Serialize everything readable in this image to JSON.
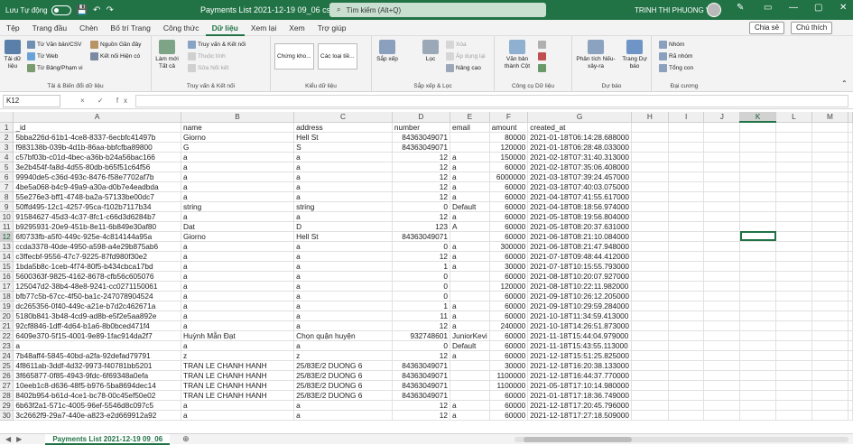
{
  "title_bar": {
    "autosave_label": "Lưu Tự động",
    "autosave_state": "off",
    "doc_title": "Payments List 2021-12-19 09_06 csv.csv",
    "search_placeholder": "Tìm kiếm (Alt+Q)",
    "user_name": "TRINH THI PHUONG VI"
  },
  "tabs": [
    "Tệp",
    "Trang đầu",
    "Chèn",
    "Bố trí Trang",
    "Công thức",
    "Dữ liệu",
    "Xem lại",
    "Xem",
    "Trợ giúp"
  ],
  "active_tab": "Dữ liệu",
  "share_label": "Chia sẻ",
  "comment_label": "Chú thích",
  "ribbon": {
    "g1": {
      "big": "Tải dữ liệu",
      "items": [
        "Từ Văn bản/CSV",
        "Từ Web",
        "Từ Bảng/Phạm vi",
        "Nguồn Gần đây",
        "Kết nối Hiện có"
      ],
      "label": "Tải & Biến đổi dữ liệu"
    },
    "g2": {
      "big": "Làm mới Tất cả",
      "items": [
        "Truy vấn & Kết nối",
        "Thuộc tính",
        "Sửa Nối kết"
      ],
      "label": "Truy vấn & Kết nối"
    },
    "g3": {
      "items": [
        "Chứng kho...",
        "Các loại tiề..."
      ],
      "label": "Kiểu dữ liệu"
    },
    "g4": {
      "items": [
        "Sắp xếp",
        "Lọc",
        "Xóa",
        "Áp dụng lại",
        "Nâng cao"
      ],
      "label": "Sắp xếp & Lọc"
    },
    "g5": {
      "items": [
        "Văn bản thành Cột"
      ],
      "label": "Công cụ Dữ liệu"
    },
    "g6": {
      "items": [
        "Phân tích Nếu-xảy-ra",
        "Trang Dự báo"
      ],
      "label": "Dự báo"
    },
    "g7": {
      "items": [
        "Nhóm",
        "Rã nhóm",
        "Tổng con"
      ],
      "label": "Đại cương"
    }
  },
  "formula_bar": {
    "name_box": "K12",
    "fx": "× ✓ fx",
    "value": ""
  },
  "columns": [
    "A",
    "B",
    "C",
    "D",
    "E",
    "F",
    "G",
    "H",
    "I",
    "J",
    "K",
    "L",
    "M"
  ],
  "selected_cell": {
    "row": 12,
    "col": "K"
  },
  "rows": [
    [
      "_id",
      "name",
      "address",
      "number",
      "email",
      "amount",
      "created_at"
    ],
    [
      "5bba226d-61b1-4ce8-8337-6ecbfc41497b",
      "Giorno",
      "Hell St",
      "84363049071",
      "",
      "80000",
      "2021-01-18T06:14:28.688000"
    ],
    [
      "f983138b-039b-4d1b-86aa-bbfcfba89800",
      "G",
      "S",
      "84363049071",
      "",
      "120000",
      "2021-01-18T06:28:48.033000"
    ],
    [
      "c57bf03b-c01d-4bec-a36b-b24a56bac166",
      "a",
      "a",
      "12",
      "a",
      "150000",
      "2021-02-18T07:31:40.313000"
    ],
    [
      "3e2b454f-fa8d-4d55-80db-b65f51c64f56",
      "a",
      "a",
      "12",
      "a",
      "60000",
      "2021-02-18T07:35:06.408000"
    ],
    [
      "99940de5-c36d-493c-8476-f58e7702af7b",
      "a",
      "a",
      "12",
      "a",
      "6000000",
      "2021-03-18T07:39:24.457000"
    ],
    [
      "4be5a068-b4c9-49a9-a30a-d0b7e4eadbda",
      "a",
      "a",
      "12",
      "a",
      "60000",
      "2021-03-18T07:40:03.075000"
    ],
    [
      "55e276e3-bff1-4748-ba2a-57133be00dc7",
      "a",
      "a",
      "12",
      "a",
      "60000",
      "2021-04-18T07:41:55.617000"
    ],
    [
      "50ffd495-12c1-4257-95ca-f102b7117b34",
      "string",
      "string",
      "0",
      "Default",
      "60000",
      "2021-04-18T08:18:56.974000"
    ],
    [
      "91584627-45d3-4c37-8fc1-c66d3d6284b7",
      "a",
      "a",
      "12",
      "a",
      "60000",
      "2021-05-18T08:19:56.804000"
    ],
    [
      "b9295931-20e9-451b-8e11-6b849e30af80",
      "Dat",
      "D",
      "123",
      "A",
      "60000",
      "2021-05-18T08:20:37.631000"
    ],
    [
      "6f0733fb-a5f0-449c-925e-4c814144a95a",
      "Giorno",
      "Hell St",
      "84363049071",
      "",
      "60000",
      "2021-06-18T08:21:10.084000"
    ],
    [
      "ccda3378-40de-4950-a598-a4e29b875ab6",
      "a",
      "a",
      "0",
      "a",
      "300000",
      "2021-06-18T08:21:47.948000"
    ],
    [
      "c3ffecbf-9556-47c7-9225-87fd980f30e2",
      "a",
      "a",
      "12",
      "a",
      "60000",
      "2021-07-18T09:48:44.412000"
    ],
    [
      "1bda5b8c-1ceb-4f74-80f5-b434cbca17bd",
      "a",
      "a",
      "1",
      "a",
      "30000",
      "2021-07-18T10:15:55.793000"
    ],
    [
      "5600363f-9825-4162-8678-cfb56c605076",
      "a",
      "a",
      "0",
      "",
      "60000",
      "2021-08-18T10:20:07.927000"
    ],
    [
      "125047d2-38b4-48e8-9241-cc0271150061",
      "a",
      "a",
      "0",
      "",
      "120000",
      "2021-08-18T10:22:11.982000"
    ],
    [
      "bfb77c5b-67cc-4f50-ba1c-247078904524",
      "a",
      "a",
      "0",
      "",
      "60000",
      "2021-09-18T10:26:12.205000"
    ],
    [
      "dc265356-0f40-449c-a21e-b7d2c462671a",
      "a",
      "a",
      "1",
      "a",
      "60000",
      "2021-09-18T10:29:59.284000"
    ],
    [
      "5180b841-3b48-4cd9-ad8b-e5f2e5aa892e",
      "a",
      "a",
      "11",
      "a",
      "60000",
      "2021-10-18T11:34:59.413000"
    ],
    [
      "92cf8846-1dff-4d64-b1a6-8b0bced471f4",
      "a",
      "a",
      "12",
      "a",
      "240000",
      "2021-10-18T14:26:51.873000"
    ],
    [
      "6409e370-5f15-4001-9e89-1fac914da2f7",
      "Huỳnh Mẫn Đạt",
      "Chọn quận huyện",
      "932748601",
      "JuniorKevi",
      "60000",
      "2021-11-18T15:44:04.979000"
    ],
    [
      "a",
      "a",
      "a",
      "0",
      "Default",
      "60000",
      "2021-11-18T15:43:55.113000"
    ],
    [
      "7b48aff4-5845-40bd-a2fa-92defad79791",
      "z",
      "z",
      "12",
      "a",
      "60000",
      "2021-12-18T15:51:25.825000"
    ],
    [
      "4f8611ab-3ddf-4d32-9973-f40781bb5201",
      "TRAN LE CHANH HANH",
      "25/83E/2 DUONG 6",
      "84363049071",
      "",
      "30000",
      "2021-12-18T16:20:38.133000"
    ],
    [
      "3f665877-0f85-4943-9fdc-6f69348a0efa",
      "TRAN LE CHANH HANH",
      "25/83E/2 DUONG 6",
      "84363049071",
      "",
      "1100000",
      "2021-12-18T16:44:37.770000"
    ],
    [
      "10eeb1c8-d636-48f5-b976-5ba8694dec14",
      "TRAN LE CHANH HANH",
      "25/83E/2 DUONG 6",
      "84363049071",
      "",
      "1100000",
      "2021-05-18T17:10:14.980000"
    ],
    [
      "8402b954-b61d-4ce1-bc78-00c45ef50e02",
      "TRAN LE CHANH HANH",
      "25/83E/2 DUONG 6",
      "84363049071",
      "",
      "60000",
      "2021-01-18T17:18:36.749000"
    ],
    [
      "6b63f2a1-571c-4005-96ef-5546d8c097c5",
      "a",
      "a",
      "12",
      "a",
      "60000",
      "2021-12-18T17:20:45.796000"
    ],
    [
      "3c2662f9-29a7-440e-a823-e2d669912a92",
      "a",
      "a",
      "12",
      "a",
      "60000",
      "2021-12-18T17:27:18.509000"
    ]
  ],
  "sheet_tab": "Payments List 2021-12-19 09_06",
  "colors": {
    "accent": "#217346"
  }
}
